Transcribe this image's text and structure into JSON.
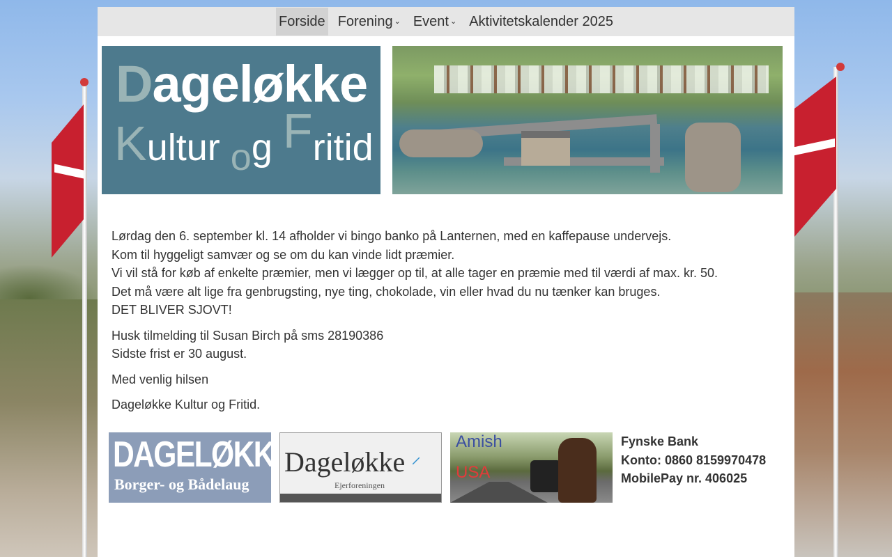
{
  "nav": {
    "items": [
      {
        "label": "Forside",
        "active": true
      },
      {
        "label": "Forening",
        "dropdown": true
      },
      {
        "label": "Event",
        "dropdown": true
      },
      {
        "label": "Aktivitetskalender 2025"
      }
    ],
    "chevron": "⌄"
  },
  "logo": {
    "line1_first": "D",
    "line1_rest": "ageløkke",
    "line2_k": "K",
    "line2_ultur": "ultur",
    "line2_o": "o",
    "line2_g": "g",
    "line2_f": "F",
    "line2_ritid": "ritid"
  },
  "content": {
    "paragraph1": [
      "Lørdag den 6. september kl. 14 afholder vi bingo banko på Lanternen, med en kaffepause undervejs.",
      "Kom til hyggeligt samvær og se om du kan vinde lidt præmier.",
      "Vi vil stå for køb af enkelte præmier, men vi lægger op til, at alle tager en præmie med til værdi af max. kr. 50.",
      "Det må være alt lige fra genbrugsting, nye ting, chokolade, vin eller hvad du nu tænker kan bruges.",
      "DET BLIVER SJOVT!"
    ],
    "paragraph2": [
      "Husk tilmelding til Susan Birch på sms 28190386",
      "Sidste frist er 30 august."
    ],
    "greeting": "Med venlig hilsen",
    "signature": "Dageløkke Kultur og Fritid."
  },
  "sponsors": {
    "borger": {
      "title": "DAGELØKKE",
      "subtitle": "Borger- og Bådelaug"
    },
    "ejer": {
      "title": "Dageløkke",
      "subtitle": "Ejerforeningen"
    },
    "amish": {
      "line1": "Amish",
      "line2": "USA"
    }
  },
  "bank": {
    "name": "Fynske Bank",
    "konto": "Konto:  0860 8159970478",
    "mobilepay": "MobilePay nr. 406025"
  },
  "colors": {
    "logo_bg": "#4d7a8d",
    "logo_accent": "#9ab4b6",
    "nav_bg": "#e6e6e6",
    "nav_active": "#d2d2d2",
    "flag_red": "#c8202f"
  }
}
